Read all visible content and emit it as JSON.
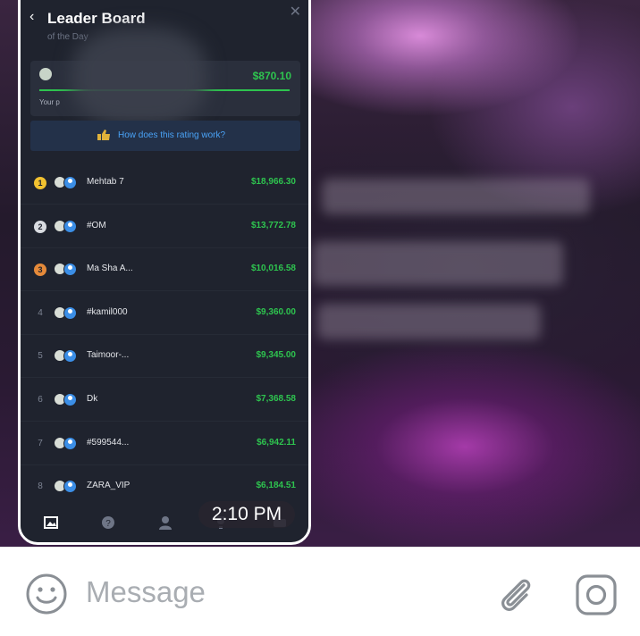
{
  "leaderboard": {
    "title": "Leader Board",
    "subtitle": "of the Day",
    "my_amount": "$870.10",
    "my_label": "Your p",
    "how_text": "How does this rating work?",
    "rows": [
      {
        "rank": "1",
        "name": "Mehtab 7",
        "amount": "$18,966.30",
        "medal": "#f2c230"
      },
      {
        "rank": "2",
        "name": "#OM",
        "amount": "$13,772.78",
        "medal": "#d9dce1"
      },
      {
        "rank": "3",
        "name": "Ma Sha A...",
        "amount": "$10,016.58",
        "medal": "#e58a3a"
      },
      {
        "rank": "4",
        "name": "#kamil000",
        "amount": "$9,360.00"
      },
      {
        "rank": "5",
        "name": "Taimoor-...",
        "amount": "$9,345.00"
      },
      {
        "rank": "6",
        "name": "Dk",
        "amount": "$7,368.58"
      },
      {
        "rank": "7",
        "name": "#599544...",
        "amount": "$6,942.11"
      },
      {
        "rank": "8",
        "name": "ZARA_VIP",
        "amount": "$6,184.51"
      }
    ]
  },
  "message": {
    "time": "2:10 PM"
  },
  "composer": {
    "placeholder": "Message"
  },
  "colors": {
    "positive": "#2ec44f",
    "link": "#4aa3f7",
    "panel": "#1f232e"
  },
  "icons": [
    "chevron-left-icon",
    "close-icon",
    "emoji-icon",
    "paperclip-icon",
    "camera-icon"
  ]
}
